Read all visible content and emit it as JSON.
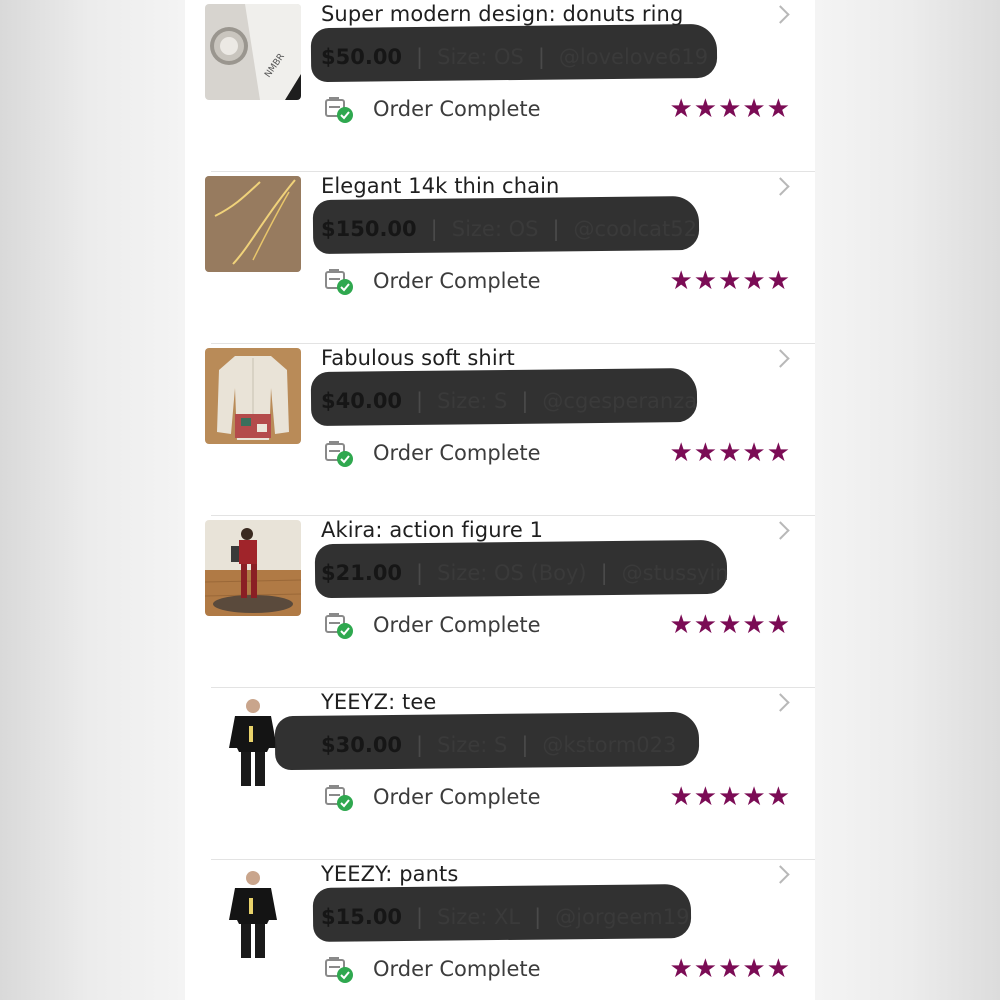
{
  "status_label": "Order Complete",
  "rating_stars": 5,
  "colors": {
    "star": "#7b0c55",
    "check": "#2fa84f",
    "scribble": "#2a2a2a"
  },
  "orders": [
    {
      "title": "Super modern design: donuts ring",
      "price": "$50.00",
      "size": "Size: OS",
      "seller": "@lovelove619",
      "thumb_text": "NMBR",
      "stars": "★★★★★"
    },
    {
      "title": "Elegant 14k thin chain",
      "price": "$150.00",
      "size": "Size: OS",
      "seller": "@coolcat52",
      "stars": "★★★★★"
    },
    {
      "title": "Fabulous soft shirt",
      "price": "$40.00",
      "size": "Size: S",
      "seller": "@cgesperanza",
      "stars": "★★★★★"
    },
    {
      "title": "Akira: action figure 1",
      "price": "$21.00",
      "size": "Size: OS (Boy)",
      "seller": "@stussyin",
      "stars": "★★★★★"
    },
    {
      "title": "YEEYZ: tee",
      "price": "$30.00",
      "size": "Size: S",
      "seller": "@kstorm023",
      "stars": "★★★★★"
    },
    {
      "title": "YEEZY: pants",
      "price": "$15.00",
      "size": "Size: XL",
      "seller": "@jorgeem19",
      "stars": "★★★★★"
    }
  ]
}
